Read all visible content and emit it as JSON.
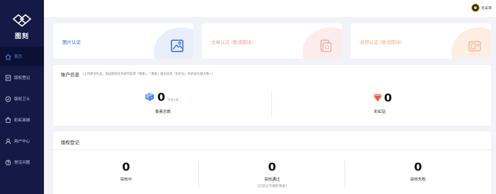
{
  "app": {
    "logo_text": "图刻"
  },
  "sidebar": {
    "items": [
      {
        "label": "首页",
        "icon": "home-icon",
        "active": true
      },
      {
        "label": "版权登记",
        "icon": "register-icon",
        "active": false
      },
      {
        "label": "版权卫士",
        "icon": "guard-icon",
        "active": false
      },
      {
        "label": "彩虹商城",
        "icon": "shop-icon",
        "active": false
      },
      {
        "label": "用户中心",
        "icon": "user-icon",
        "active": false
      },
      {
        "label": "常见问题",
        "icon": "question-icon",
        "active": false
      }
    ]
  },
  "header": {
    "username": "无采率"
  },
  "auth_cards": [
    {
      "title": "图片认证",
      "color": "#2f6bde"
    },
    {
      "title": "文章认证 (敬请期待)",
      "color": "#f0a0a0"
    },
    {
      "title": "视频认证 (敬请期待)",
      "color": "#f2b08a"
    }
  ],
  "account": {
    "title": "账户信息",
    "note": "(上传原创作品，则成图刻任务即可获得「像素」，「像素」越多获得「彩虹钻」的机会也越大哦~)",
    "pixels": {
      "value": "0",
      "today_label": "今日",
      "today_value": "+0",
      "label": "像素总数"
    },
    "diamond": {
      "value": "0",
      "label": "彩虹钻"
    }
  },
  "copyright": {
    "title": "版权登记",
    "stats": [
      {
        "value": "0",
        "label": "审核中",
        "note": ""
      },
      {
        "value": "0",
        "label": "审核通过",
        "note": "(已登记可赚取像素)"
      },
      {
        "value": "0",
        "label": "审核失败",
        "note": ""
      }
    ]
  }
}
